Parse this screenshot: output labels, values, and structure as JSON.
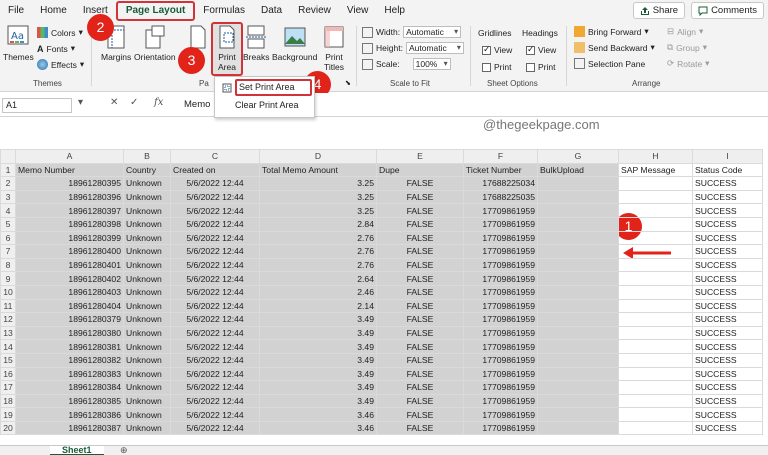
{
  "menu": [
    "File",
    "Home",
    "Insert",
    "Page Layout",
    "Formulas",
    "Data",
    "Review",
    "View",
    "Help"
  ],
  "share_label": "Share",
  "comments_label": "Comments",
  "ribbon": {
    "themes": {
      "themes_label": "Themes",
      "colors": "Colors",
      "fonts": "Fonts",
      "effects": "Effects",
      "group": "Themes"
    },
    "page_setup": {
      "margins": "Margins",
      "orientation": "Orientation",
      "print_area_line1": "Print",
      "print_area_line2": "Area",
      "breaks": "Breaks",
      "background": "Background",
      "print_titles_line1": "Print",
      "print_titles_line2": "Titles",
      "group": "Pa"
    },
    "scale": {
      "width_label": "Width:",
      "width_value": "Automatic",
      "height_label": "Height:",
      "height_value": "Automatic",
      "scale_label": "Scale:",
      "scale_value": "100%",
      "group": "Scale to Fit"
    },
    "sheet_options": {
      "gridlines": "Gridlines",
      "headings": "Headings",
      "view": "View",
      "print": "Print",
      "group": "Sheet Options"
    },
    "arrange": {
      "bring_forward": "Bring Forward",
      "send_backward": "Send Backward",
      "selection_pane": "Selection Pane",
      "align": "Align",
      "group_btn": "Group",
      "rotate": "Rotate",
      "group": "Arrange"
    }
  },
  "popup": {
    "set_print_area": "Set Print Area",
    "clear_print_area": "Clear Print Area"
  },
  "badges": [
    "2",
    "3",
    "4",
    "1"
  ],
  "formula_bar": {
    "name_box": "A1",
    "fx": "fx",
    "content": "Memo"
  },
  "watermark": "@thegeekpage.com",
  "columns": [
    "A",
    "B",
    "C",
    "D",
    "E",
    "F",
    "G",
    "H",
    "I"
  ],
  "headers": [
    "Memo Number",
    "Country",
    "Created on",
    "Total Memo Amount",
    "Dupe",
    "Ticket Number",
    "BulkUpload",
    "SAP Message",
    "Status Code"
  ],
  "rows": [
    [
      "18961280395",
      "Unknown",
      "5/6/2022 12:44",
      "3.25",
      "FALSE",
      "17688225034",
      "",
      "",
      "SUCCESS"
    ],
    [
      "18961280396",
      "Unknown",
      "5/6/2022 12:44",
      "3.25",
      "FALSE",
      "17688225035",
      "",
      "",
      "SUCCESS"
    ],
    [
      "18961280397",
      "Unknown",
      "5/6/2022 12:44",
      "3.25",
      "FALSE",
      "17709861959",
      "",
      "",
      "SUCCESS"
    ],
    [
      "18961280398",
      "Unknown",
      "5/6/2022 12:44",
      "2.84",
      "FALSE",
      "17709861959",
      "",
      "",
      "SUCCESS"
    ],
    [
      "18961280399",
      "Unknown",
      "5/6/2022 12:44",
      "2.76",
      "FALSE",
      "17709861959",
      "",
      "",
      "SUCCESS"
    ],
    [
      "18961280400",
      "Unknown",
      "5/6/2022 12:44",
      "2.76",
      "FALSE",
      "17709861959",
      "",
      "",
      "SUCCESS"
    ],
    [
      "18961280401",
      "Unknown",
      "5/6/2022 12:44",
      "2.76",
      "FALSE",
      "17709861959",
      "",
      "",
      "SUCCESS"
    ],
    [
      "18961280402",
      "Unknown",
      "5/6/2022 12:44",
      "2.64",
      "FALSE",
      "17709861959",
      "",
      "",
      "SUCCESS"
    ],
    [
      "18961280403",
      "Unknown",
      "5/6/2022 12:44",
      "2.46",
      "FALSE",
      "17709861959",
      "",
      "",
      "SUCCESS"
    ],
    [
      "18961280404",
      "Unknown",
      "5/6/2022 12:44",
      "2.14",
      "FALSE",
      "17709861959",
      "",
      "",
      "SUCCESS"
    ],
    [
      "18961280379",
      "Unknown",
      "5/6/2022 12:44",
      "3.49",
      "FALSE",
      "17709861959",
      "",
      "",
      "SUCCESS"
    ],
    [
      "18961280380",
      "Unknown",
      "5/6/2022 12:44",
      "3.49",
      "FALSE",
      "17709861959",
      "",
      "",
      "SUCCESS"
    ],
    [
      "18961280381",
      "Unknown",
      "5/6/2022 12:44",
      "3.49",
      "FALSE",
      "17709861959",
      "",
      "",
      "SUCCESS"
    ],
    [
      "18961280382",
      "Unknown",
      "5/6/2022 12:44",
      "3.49",
      "FALSE",
      "17709861959",
      "",
      "",
      "SUCCESS"
    ],
    [
      "18961280383",
      "Unknown",
      "5/6/2022 12:44",
      "3.49",
      "FALSE",
      "17709861959",
      "",
      "",
      "SUCCESS"
    ],
    [
      "18961280384",
      "Unknown",
      "5/6/2022 12:44",
      "3.49",
      "FALSE",
      "17709861959",
      "",
      "",
      "SUCCESS"
    ],
    [
      "18961280385",
      "Unknown",
      "5/6/2022 12:44",
      "3.49",
      "FALSE",
      "17709861959",
      "",
      "",
      "SUCCESS"
    ],
    [
      "18961280386",
      "Unknown",
      "5/6/2022 12:44",
      "3.46",
      "FALSE",
      "17709861959",
      "",
      "",
      "SUCCESS"
    ],
    [
      "18961280387",
      "Unknown",
      "5/6/2022 12:44",
      "3.46",
      "FALSE",
      "17709861959",
      "",
      "",
      "SUCCESS"
    ]
  ],
  "sheet_tab": "Sheet1",
  "colors": {
    "accent": "#185c37",
    "highlight": "#d13438",
    "badge": "#e2231a",
    "selection": "#d2d2d2"
  }
}
